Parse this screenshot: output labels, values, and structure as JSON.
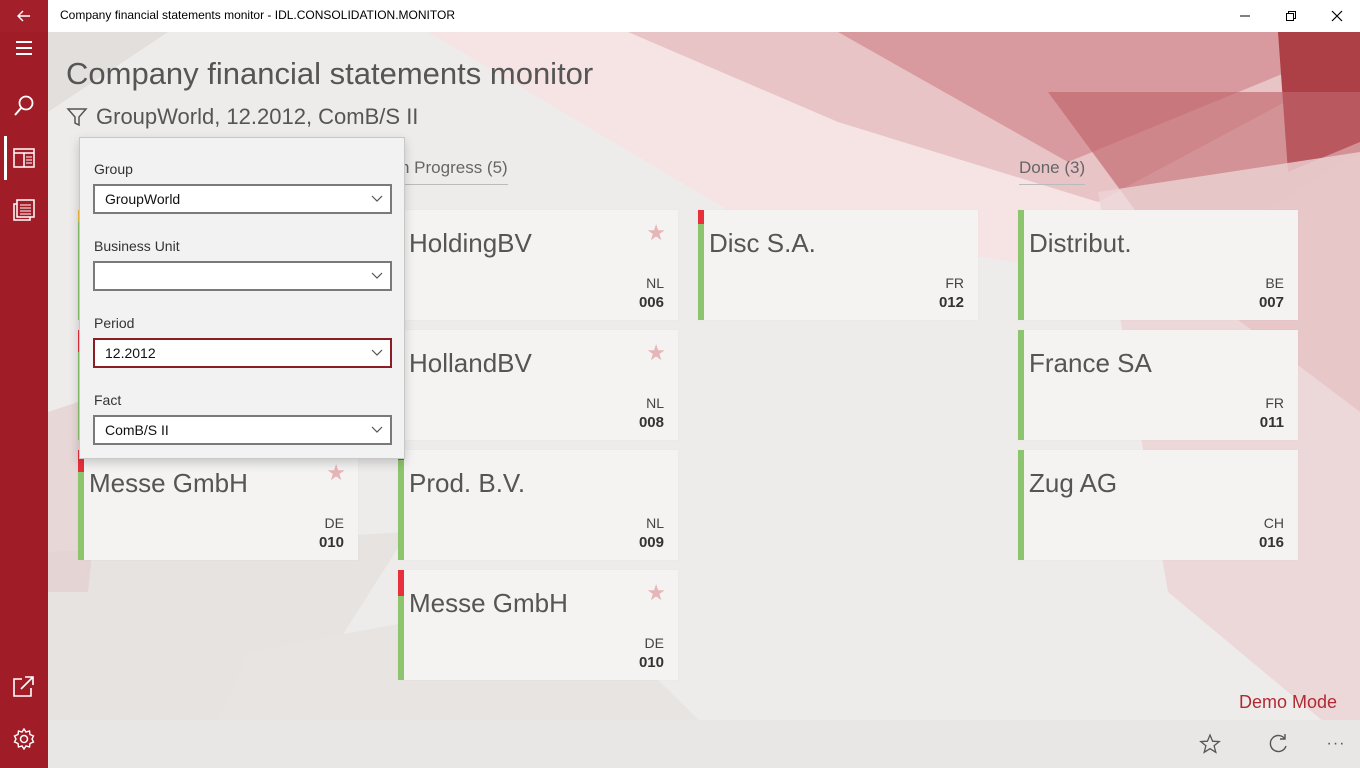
{
  "window": {
    "title": "Company financial statements monitor - IDL.CONSOLIDATION.MONITOR",
    "back_icon": "back-arrow-icon",
    "minimize_icon": "minimize-icon",
    "restore_icon": "restore-icon",
    "close_icon": "close-icon"
  },
  "sidebar": {
    "items": [
      {
        "icon": "hamburger-menu-icon"
      },
      {
        "icon": "search-icon"
      },
      {
        "icon": "dashboard-icon",
        "active": true
      },
      {
        "icon": "report-list-icon"
      },
      {
        "icon": "open-external-icon"
      },
      {
        "icon": "settings-gear-icon"
      }
    ],
    "accent": "#a01d28"
  },
  "header": {
    "title": "Company financial statements monitor",
    "filter_summary": "GroupWorld, 12.2012, ComB/S II"
  },
  "columns": [
    {
      "header": "n Progress (5)",
      "cards": [
        {
          "name": "HoldingBV",
          "country": "NL",
          "code": "006",
          "starred": true,
          "status_red": false
        },
        {
          "name": "HollandBV",
          "country": "NL",
          "code": "008",
          "starred": true,
          "status_red": false
        },
        {
          "name": "Prod. B.V.",
          "country": "NL",
          "code": "009",
          "starred": false,
          "status_red": true
        },
        {
          "name": "Messe GmbH",
          "country": "DE",
          "code": "010",
          "starred": true,
          "status_red": true
        }
      ]
    },
    {
      "header": "",
      "cards": [
        {
          "name": "Disc S.A.",
          "country": "FR",
          "code": "012",
          "starred": false,
          "status_red": true
        }
      ]
    },
    {
      "header": "Done (3)",
      "cards": [
        {
          "name": "Distribut.",
          "country": "BE",
          "code": "007",
          "starred": false,
          "status_red": false
        },
        {
          "name": "France SA",
          "country": "FR",
          "code": "011",
          "starred": false,
          "status_red": false
        },
        {
          "name": "Zug AG",
          "country": "CH",
          "code": "016",
          "starred": false,
          "status_red": false
        }
      ]
    }
  ],
  "left_column_partial_card": {
    "name": "Messe GmbH",
    "country": "DE",
    "code": "010",
    "starred": true,
    "status_red": true
  },
  "filter_panel": {
    "group": {
      "label": "Group",
      "value": "GroupWorld"
    },
    "business_unit": {
      "label": "Business Unit",
      "value": ""
    },
    "period": {
      "label": "Period",
      "value": "12.2012"
    },
    "fact": {
      "label": "Fact",
      "value": "ComB/S II"
    }
  },
  "demo_mode": "Demo Mode",
  "appbar": {
    "favorite_icon": "star-outline-icon",
    "refresh_icon": "refresh-icon",
    "more_icon": "more-ellipsis-icon",
    "more_label": "···"
  },
  "colors": {
    "status_green": "#8cc56e",
    "status_red": "#e8303c",
    "star": "#e6b5b8",
    "brand": "#a01d28"
  }
}
